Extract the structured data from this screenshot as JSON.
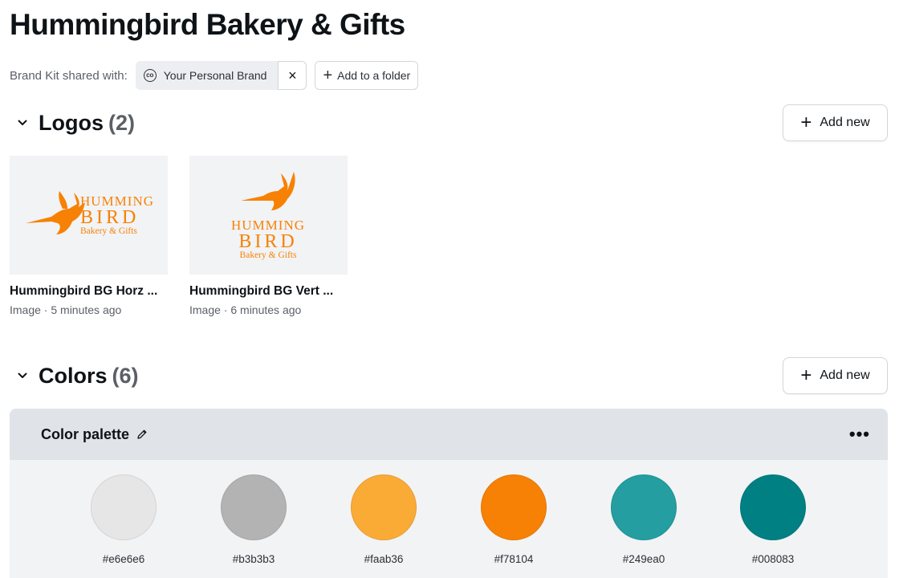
{
  "page": {
    "title": "Hummingbird Bakery & Gifts"
  },
  "share": {
    "label": "Brand Kit shared with:",
    "chip_label": "Your Personal Brand",
    "chip_icon": "brand-icon",
    "remove_icon": "×",
    "folder_label": "Add to a folder"
  },
  "logos_section": {
    "title": "Logos",
    "count": "(2)",
    "add_label": "Add new",
    "items": [
      {
        "name": "Hummingbird BG Horz ...",
        "meta": "Image · 5 minutes ago",
        "line1": "HUMMING",
        "line2": "BIRD",
        "line3": "Bakery & Gifts"
      },
      {
        "name": "Hummingbird BG Vert ...",
        "meta": "Image · 6 minutes ago",
        "line1": "HUMMING",
        "line2": "BIRD",
        "line3": "Bakery & Gifts"
      }
    ]
  },
  "colors_section": {
    "title": "Colors",
    "count": "(6)",
    "add_label": "Add new",
    "palette_title": "Color palette",
    "more_label": "•••",
    "swatches": [
      {
        "hex": "#e6e6e6",
        "label": "#e6e6e6"
      },
      {
        "hex": "#b3b3b3",
        "label": "#b3b3b3"
      },
      {
        "hex": "#faab36",
        "label": "#faab36"
      },
      {
        "hex": "#f78104",
        "label": "#f78104"
      },
      {
        "hex": "#249ea0",
        "label": "#249ea0"
      },
      {
        "hex": "#008083",
        "label": "#008083"
      }
    ]
  },
  "colors": {
    "brand_orange": "#f78104",
    "text": "#0e1318",
    "muted": "#5b6066"
  }
}
